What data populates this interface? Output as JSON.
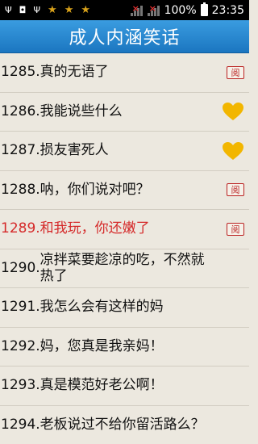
{
  "status_bar": {
    "battery_percent": "100%",
    "time": "23:35"
  },
  "title": "成人内涵笑话",
  "items": [
    {
      "number": "1285.",
      "title": "真的无语了",
      "marker": "阅",
      "marker_type": "read"
    },
    {
      "number": "1286.",
      "title": "我能说些什么",
      "marker_type": "favorite"
    },
    {
      "number": "1287.",
      "title": "损友害死人",
      "marker_type": "favorite"
    },
    {
      "number": "1288.",
      "title": "呐，你们说对吧？",
      "marker": "阅",
      "marker_type": "read"
    },
    {
      "number": "1289.",
      "title": "和我玩，你还嫩了",
      "marker": "阅",
      "marker_type": "read",
      "highlighted": true
    },
    {
      "number": "1290.",
      "title": "凉拌菜要趁凉的吃，不然就热了"
    },
    {
      "number": "1291.",
      "title": "我怎么会有这样的妈"
    },
    {
      "number": "1292.",
      "title": "妈，您真是我亲妈！"
    },
    {
      "number": "1293.",
      "title": "真是模范好老公啊！"
    },
    {
      "number": "1294.",
      "title": "老板说过不给你留活路么？"
    }
  ],
  "colors": {
    "title_bar": "#1b76c0",
    "highlight_text": "#d52a2a",
    "favorite_heart": "#f2b600",
    "read_badge": "#b22222"
  }
}
